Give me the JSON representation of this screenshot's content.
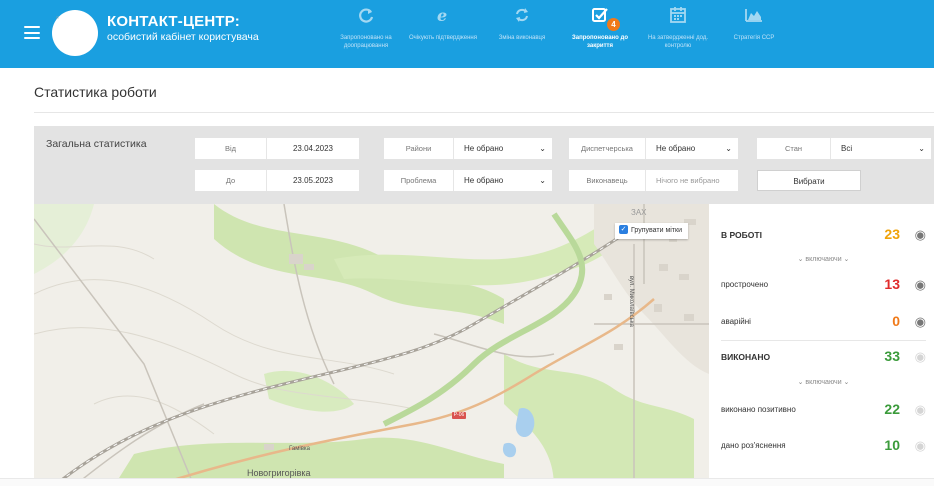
{
  "header": {
    "brand_title": "КОНТАКТ-ЦЕНТР:",
    "brand_subtitle": "особистий кабінет користувача",
    "nav": [
      {
        "label": "Запропоновано на доопрацювання",
        "icon": "refresh-icon"
      },
      {
        "label": "Очікують підтвердження",
        "icon": "browser-e-icon"
      },
      {
        "label": "Зміна виконавця",
        "icon": "sync-icon"
      },
      {
        "label": "Запропоновано до закриття",
        "icon": "checkbox-icon",
        "badge": "4"
      },
      {
        "label": "На затвердженні дод. контролю",
        "icon": "calendar-icon"
      },
      {
        "label": "Стратегія ССР",
        "icon": "area-chart-icon"
      }
    ]
  },
  "page": {
    "title": "Статистика роботи"
  },
  "filters": {
    "section_title": "Загальна статистика",
    "from_label": "Від",
    "from_value": "23.04.2023",
    "to_label": "До",
    "to_value": "23.05.2023",
    "districts_label": "Райони",
    "districts_value": "Не обрано",
    "problem_label": "Проблема",
    "problem_value": "Не обрано",
    "dispatch_label": "Диспетчерська",
    "dispatch_value": "Не обрано",
    "executor_label": "Виконавець",
    "executor_value": "Нічого не вибрано",
    "state_label": "Стан",
    "state_value": "Всі",
    "select_button": "Вибрати"
  },
  "map": {
    "group_markers_label": "Групувати мітки",
    "street_label": "вул. Миколаївська",
    "district_label": "ЗАХ",
    "town_label": "Новогригорівка",
    "small_label": "Гамівка",
    "road_sign": "Р-06"
  },
  "stats": {
    "in_work_label": "В РОБОТІ",
    "in_work_value": "23",
    "in_work_color": "#f0a30a",
    "including_label": "⌄ включаючи ⌄",
    "overdue_label": "прострочено",
    "overdue_value": "13",
    "overdue_color": "#e02b2b",
    "emergency_label": "аварійні",
    "emergency_value": "0",
    "emergency_color": "#f07a1a",
    "done_label": "ВИКОНАНО",
    "done_value": "33",
    "done_color": "#3b9b3b",
    "done_positive_label": "виконано позитивно",
    "done_positive_value": "22",
    "explained_label": "дано роз'яснення",
    "explained_value": "10",
    "accent_color": "#1a9fe0"
  }
}
